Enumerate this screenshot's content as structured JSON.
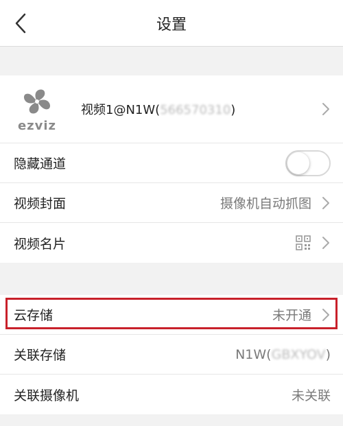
{
  "header": {
    "title": "设置"
  },
  "device": {
    "logo_text": "ezviz",
    "name_prefix": "视频1@N1W(",
    "name_masked": "566570310",
    "name_suffix": ")"
  },
  "section1": {
    "hide_channel": {
      "label": "隐藏通道",
      "toggle_on": false
    },
    "cover": {
      "label": "视频封面",
      "value": "摄像机自动抓图"
    },
    "card": {
      "label": "视频名片"
    }
  },
  "section2": {
    "cloud": {
      "label": "云存储",
      "value": "未开通"
    },
    "linked_storage": {
      "label": "关联存储",
      "value_prefix": "N1W(",
      "value_masked": "GBXYOV",
      "value_suffix": ")"
    },
    "linked_camera": {
      "label": "关联摄像机",
      "value": "未关联"
    }
  },
  "icons": [
    "back-arrow-icon",
    "ezviz-logo-icon",
    "chevron-right-icon",
    "qr-code-icon"
  ],
  "colors": {
    "highlight": "#c8202a",
    "background": "#f2f2f2"
  }
}
